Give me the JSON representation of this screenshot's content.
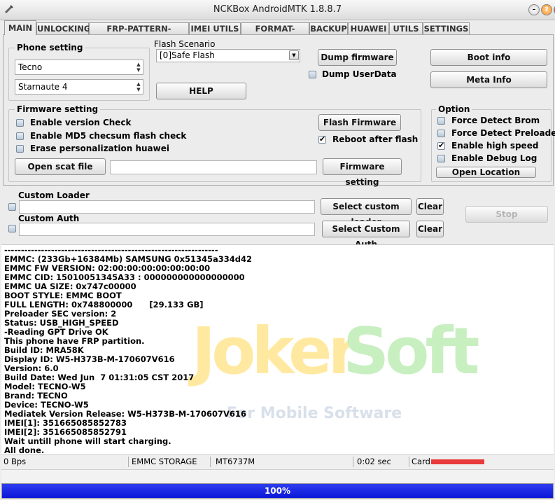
{
  "window": {
    "title": "NCKBox AndroidMTK 1.8.8.7"
  },
  "tabs": [
    "MAIN",
    "UNLOCKING",
    "FRP-PATTERN-PRIVACY",
    "IMEI UTILS",
    "FORMAT-RESET",
    "BACKUP",
    "HUAWEI",
    "UTILS",
    "SETTINGS"
  ],
  "phone_setting": {
    "label": "Phone setting",
    "brand": "Tecno",
    "model": "Starnaute 4"
  },
  "flash": {
    "scenario_label": "Flash Scenario",
    "scenario_value": "[0]Safe Flash",
    "dump_firmware": "Dump firmware",
    "dump_userdata": "Dump UserData",
    "help": "HELP",
    "boot_info": "Boot info",
    "meta_info": "Meta Info"
  },
  "firmware": {
    "label": "Firmware setting",
    "enable_version_check": "Enable version Check",
    "enable_md5": "Enable MD5 checsum flash check",
    "erase_personalization": "Erase personalization huawei",
    "open_scat": "Open scat file",
    "flash_firmware": "Flash Firmware",
    "reboot_after_flash": "Reboot after flash",
    "firmware_setting": "Firmware setting"
  },
  "option": {
    "label": "Option",
    "force_brom": "Force Detect Brom",
    "force_preloader": "Force Detect Preloader",
    "high_speed": "Enable high speed porl",
    "debug_log": "Enable Debug Log",
    "open_location": "Open Location"
  },
  "loader": {
    "custom_loader_label": "Custom Loader",
    "custom_auth_label": "Custom Auth",
    "select_loader": "Select custom loader",
    "select_auth": "Select Custom Auth",
    "clear": "Clear",
    "stop": "Stop"
  },
  "watermark": {
    "part1": "Joker",
    "part2": "Soft",
    "tagline": "For Mobile Software"
  },
  "log": [
    "----------------------------------------------------------------",
    "EMMC: (233Gb+16384Mb) SAMSUNG 0x51345a334d42",
    "EMMC FW VERSION: 02:00:00:00:00:00:00:00",
    "EMMC CID: 15010051345A33 : 000000000000000000",
    "EMMC UA SIZE: 0x747c00000",
    "BOOT STYLE: EMMC BOOT",
    "FULL LENGTH: 0x748800000      [29.133 GB]",
    "Preloader SEC version: 2",
    "Status: USB_HIGH_SPEED",
    "-Reading GPT Drive OK",
    "This phone have FRP partition.",
    "Build ID: MRA58K",
    "Display ID: W5-H373B-M-170607V616",
    "Version: 6.0",
    "Build Date: Wed Jun  7 01:31:05 CST 2017",
    "Model: TECNO-W5",
    "Brand: TECNO",
    "Device: TECNO-W5",
    "Mediatek Version Release: W5-H373B-M-170607V616",
    "IMEI[1]: 351665085852783",
    "IMEI[2]: 351665085852791",
    "Wait untill phone will start charging.",
    "All done."
  ],
  "status": {
    "speed": "0 Bps",
    "storage": "EMMC STORAGE",
    "chip": "MT6737M",
    "time": "0:02 sec",
    "card": "Card"
  },
  "progress": {
    "value": 1.0,
    "label": "100%"
  },
  "colors": {
    "progress": "#0a18d8",
    "redact": "#e83a3a"
  }
}
